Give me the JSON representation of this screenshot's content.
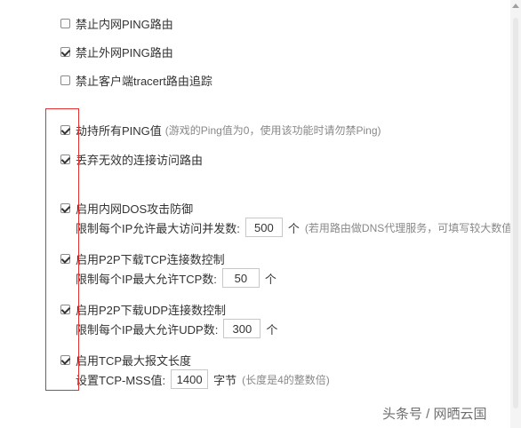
{
  "options": [
    {
      "label": "禁止内网PING路由",
      "checked": false
    },
    {
      "label": "禁止外网PING路由",
      "checked": true
    },
    {
      "label": "禁止客户端tracert路由追踪",
      "checked": false
    },
    {
      "label": "劫持所有PING值",
      "hint": "(游戏的Ping值为0，使用该功能时请勿禁Ping)",
      "checked": true
    },
    {
      "label": "丢弃无效的连接访问路由",
      "checked": true
    },
    {
      "label": "启用内网DOS攻击防御",
      "checked": true
    },
    {
      "label": "启用P2P下载TCP连接数控制",
      "checked": true
    },
    {
      "label": "启用P2P下载UDP连接数控制",
      "checked": true
    },
    {
      "label": "启用TCP最大报文长度",
      "checked": true
    }
  ],
  "dos": {
    "label": "限制每个IP允许最大访问并发数:",
    "value": "500",
    "unit": "个",
    "hint": "(若用路由做DNS代理服务，可填写较大数值)"
  },
  "tcp": {
    "label": "限制每个IP最大允许TCP数:",
    "value": "50",
    "unit": "个"
  },
  "udp": {
    "label": "限制每个IP最大允许UDP数:",
    "value": "300",
    "unit": "个"
  },
  "mss": {
    "label": "设置TCP-MSS值:",
    "value": "1400",
    "unit": "字节",
    "hint": "(长度是4的整数倍)"
  },
  "watermark": "头条号 / 网晒云国",
  "colors": {
    "highlight": "#e03030",
    "text": "#333333",
    "hint": "#888888"
  }
}
